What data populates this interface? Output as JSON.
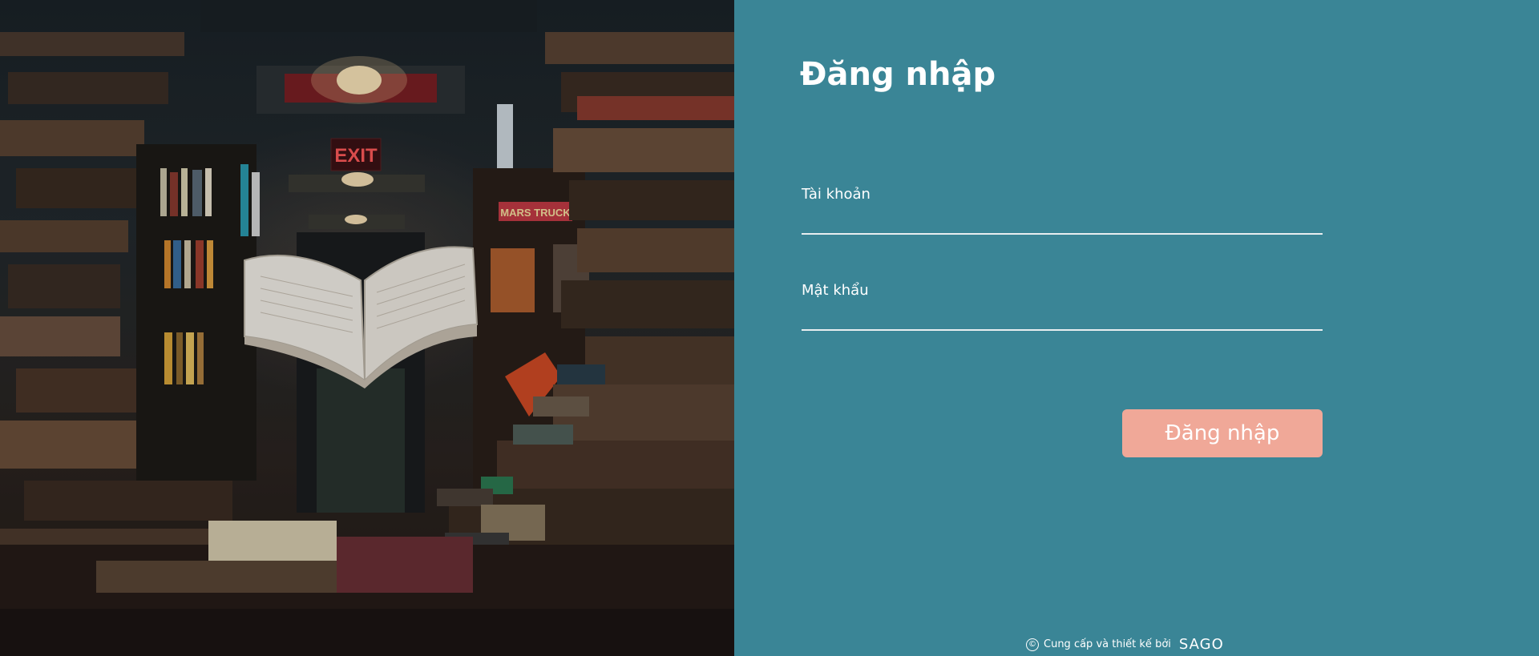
{
  "login": {
    "title": "Đăng nhập",
    "username_label": "Tài khoản",
    "username_value": "",
    "password_label": "Mật khẩu",
    "password_value": "",
    "submit_label": "Đăng nhập"
  },
  "photo": {
    "exit_sign": "EXIT",
    "shelf_sign": "MARS TRUCK"
  },
  "footer": {
    "copyright_icon": "©",
    "credit_text": "Cung cấp và thiết kế bởi",
    "brand": "SAGO"
  },
  "colors": {
    "panel_bg": "#3a8596",
    "button_bg": "#f0a898",
    "text": "#ffffff"
  }
}
